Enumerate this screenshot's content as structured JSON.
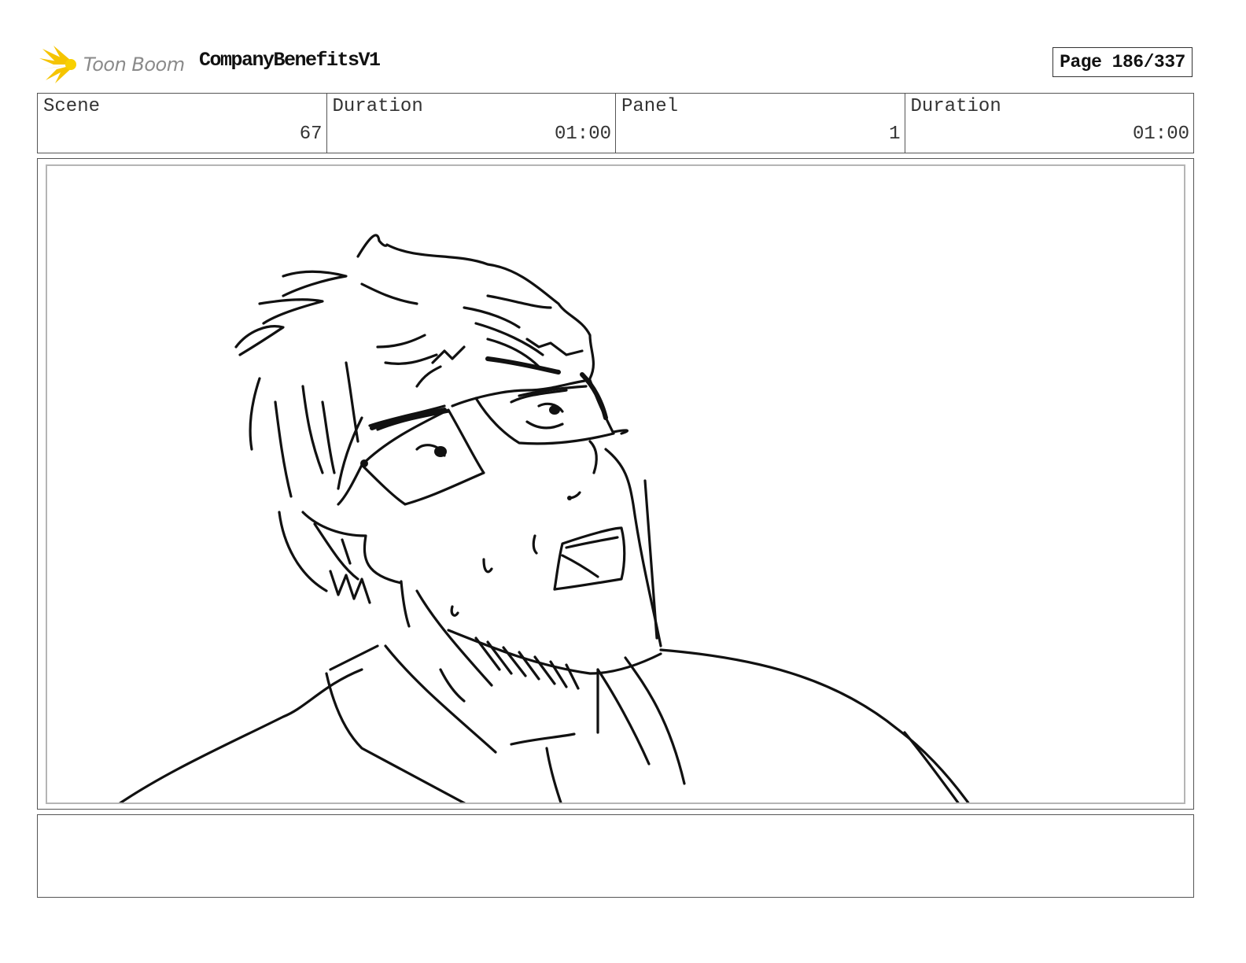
{
  "header": {
    "logo_text": "Toon Boom",
    "project_title": "CompanyBenefitsV1",
    "page_indicator": "Page 186/337"
  },
  "info": {
    "scene_label": "Scene",
    "scene_value": "67",
    "scene_duration_label": "Duration",
    "scene_duration_value": "01:00",
    "panel_label": "Panel",
    "panel_value": "1",
    "panel_duration_label": "Duration",
    "panel_duration_value": "01:00"
  },
  "panel": {
    "drawing": "sketch-character-with-glasses-icon"
  },
  "notes": {
    "text": ""
  },
  "colors": {
    "logo_accent": "#f5c400",
    "logo_text": "#8a8a8a",
    "border": "#555555",
    "inner_border": "#b5b5b5"
  }
}
